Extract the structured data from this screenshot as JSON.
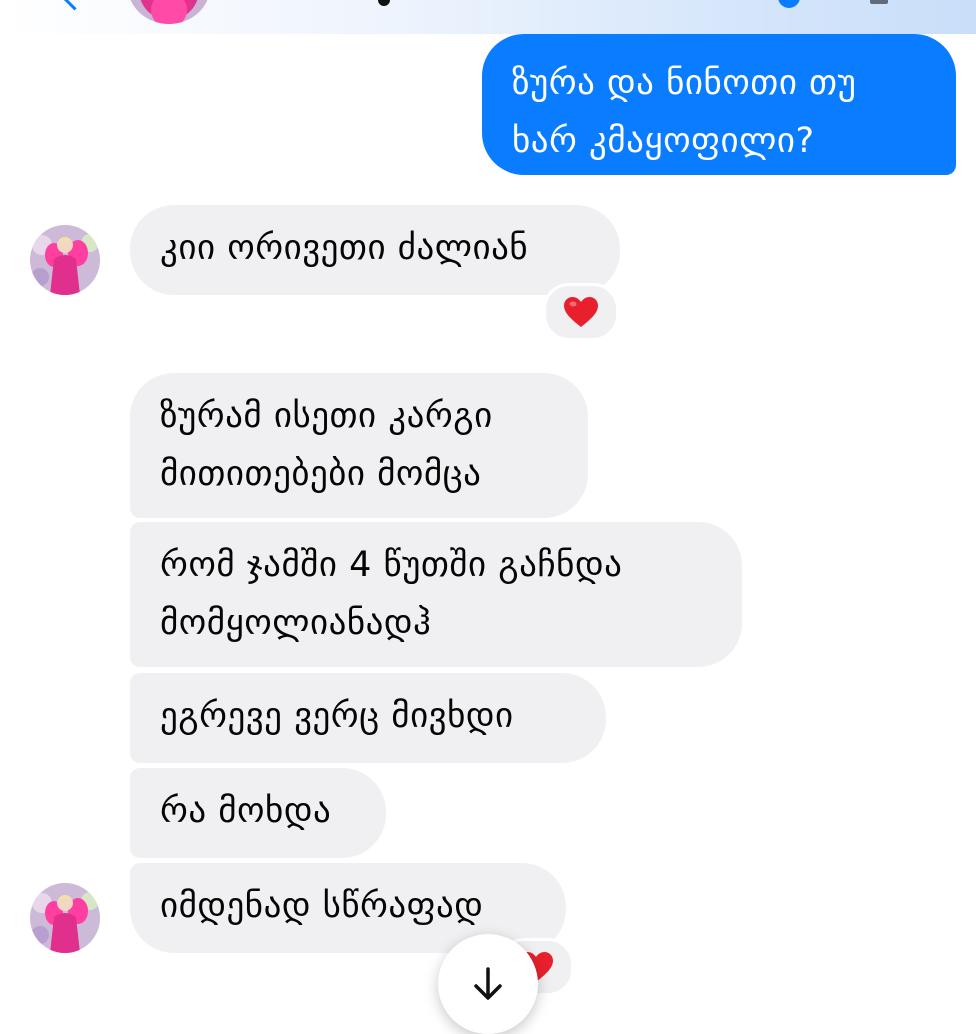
{
  "colors": {
    "outgoing_bubble": "#0a7cff",
    "incoming_bubble": "#f0f0f2",
    "reaction_heart": "#e8202e"
  },
  "header": {
    "avatar_icon": "contact-avatar",
    "back_icon": "back-chevron-icon"
  },
  "messages": {
    "outgoing_1": {
      "line1": "ზურა და ნინოთი თუ",
      "line2": "ხარ კმაყოფილი?"
    },
    "incoming_1": {
      "text": "კიი ორივეთი ძალიან",
      "reaction": "heart-icon"
    },
    "incoming_2": {
      "line1": "ზურამ ისეთი კარგი",
      "line2": "მითითებები მომცა"
    },
    "incoming_3": {
      "line1": "რომ ჯამში 4 წუთში გაჩნდა",
      "line2": "მომყოლიანადჰ"
    },
    "incoming_4": {
      "text": "ეგრევე ვერც მივხდი"
    },
    "incoming_5": {
      "text": "რა მოხდა"
    },
    "incoming_6": {
      "text": "იმდენად სწრაფად",
      "reaction": "heart-icon"
    }
  },
  "controls": {
    "scroll_down_icon": "arrow-down-icon"
  }
}
